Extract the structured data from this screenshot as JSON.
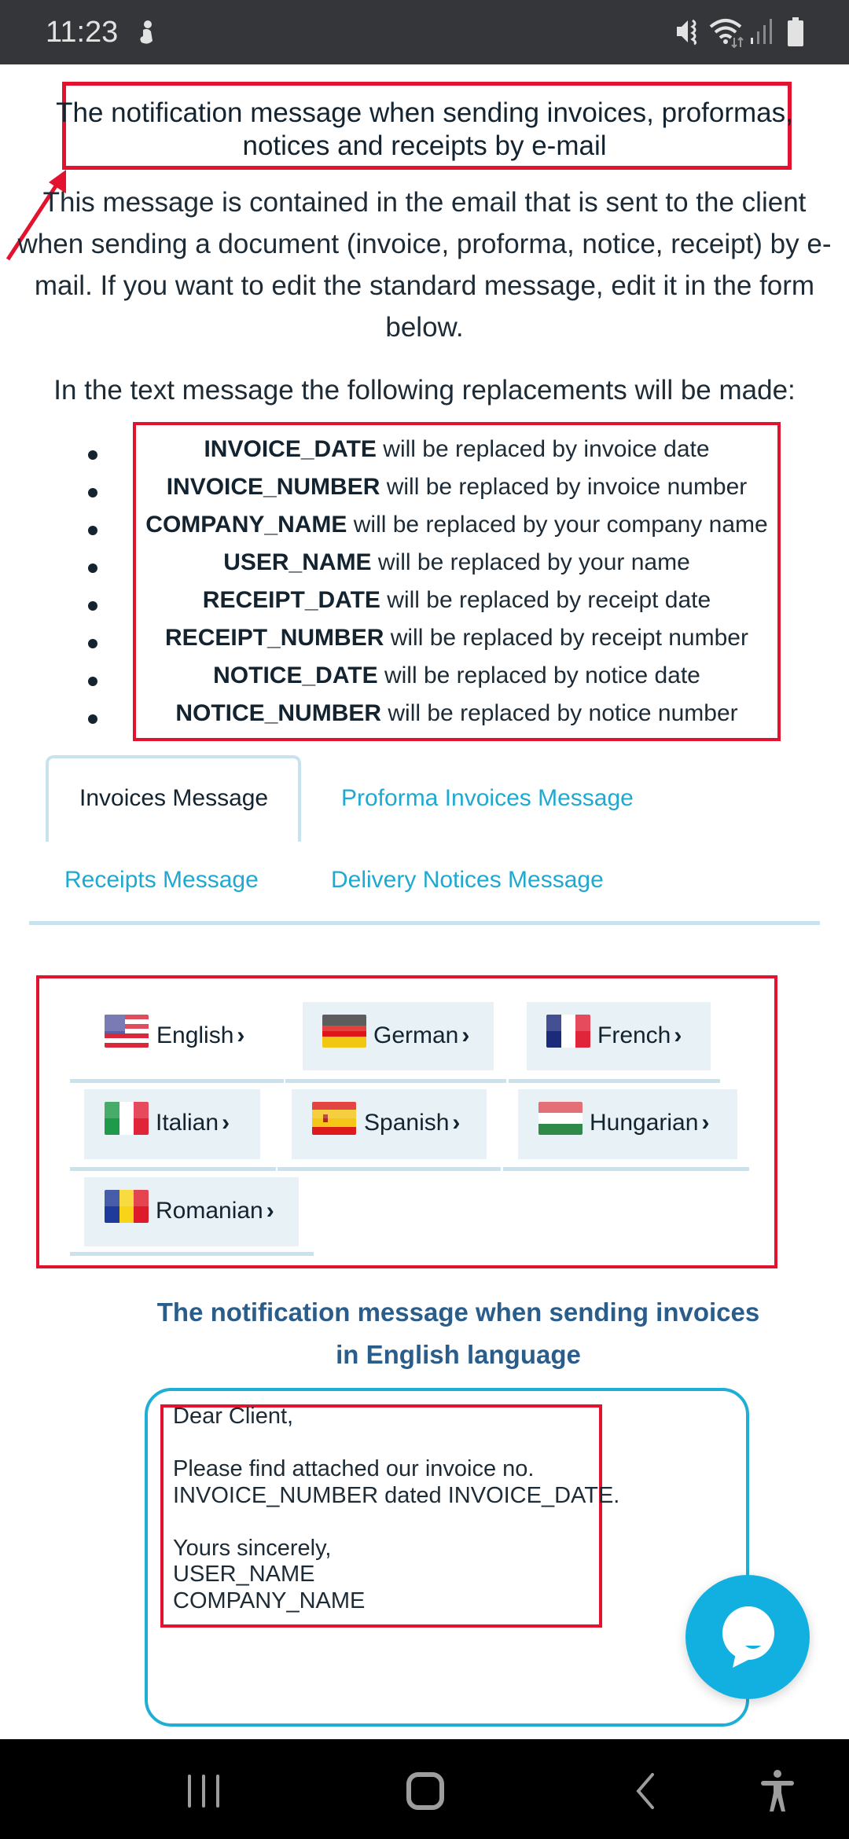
{
  "status_bar": {
    "time": "11:23",
    "icons": [
      "person-notification-icon",
      "mute-vibrate-icon",
      "wifi-data-icon",
      "signal-icon",
      "battery-icon"
    ]
  },
  "headline": {
    "line1": "The notification message when sending invoices, proformas,",
    "line2": "notices and receipts by e-mail"
  },
  "intro": {
    "lines": [
      "This message is contained in the email that is sent to the client",
      "when sending a document (invoice, proforma, notice, receipt) by e-",
      "mail. If you want to edit the standard message, edit it in the form",
      "below."
    ]
  },
  "replacements": {
    "intro": "In the text message the following replacements will be made:",
    "items": [
      {
        "key": "INVOICE_DATE",
        "text": " will be replaced by invoice date"
      },
      {
        "key": "INVOICE_NUMBER",
        "text": " will be replaced by invoice number"
      },
      {
        "key": "COMPANY_NAME",
        "text": " will be replaced by your company name"
      },
      {
        "key": "USER_NAME",
        "text": " will be replaced by your name"
      },
      {
        "key": "RECEIPT_DATE",
        "text": " will be replaced by receipt date"
      },
      {
        "key": "RECEIPT_NUMBER",
        "text": " will be replaced by receipt number"
      },
      {
        "key": "NOTICE_DATE",
        "text": " will be replaced by notice date"
      },
      {
        "key": "NOTICE_NUMBER",
        "text": " will be replaced by notice number"
      }
    ]
  },
  "tabs": {
    "items": [
      {
        "label": "Invoices Message",
        "active": true
      },
      {
        "label": "Proforma Invoices Message",
        "active": false
      },
      {
        "label": "Receipts Message",
        "active": false
      },
      {
        "label": "Delivery Notices Message",
        "active": false
      }
    ]
  },
  "languages": {
    "chevron": "›",
    "items": [
      {
        "label": "English",
        "flag": "us-flag-icon",
        "selected": true
      },
      {
        "label": "German",
        "flag": "germany-flag-icon",
        "selected": false
      },
      {
        "label": "French",
        "flag": "france-flag-icon",
        "selected": false
      },
      {
        "label": "Italian",
        "flag": "italy-flag-icon",
        "selected": false
      },
      {
        "label": "Spanish",
        "flag": "spain-flag-icon",
        "selected": false
      },
      {
        "label": "Hungarian",
        "flag": "hungary-flag-icon",
        "selected": false
      },
      {
        "label": "Romanian",
        "flag": "romania-flag-icon",
        "selected": false
      }
    ]
  },
  "message_section": {
    "title_line1": "The notification message when sending invoices",
    "title_line2": "in English language",
    "textarea_lines": [
      "Dear Client,",
      "",
      "Please find attached our invoice no.",
      "INVOICE_NUMBER dated INVOICE_DATE.",
      "",
      "Yours sincerely,",
      "USER_NAME",
      "COMPANY_NAME"
    ]
  },
  "colors": {
    "annotation_red": "#e3132f",
    "link_blue": "#1fa9d1",
    "accent_cyan": "#12b0e0",
    "tab_border": "#c9e3ee",
    "subtitle_blue": "#2a5d8a"
  },
  "nav_bar": {
    "buttons": [
      "recent-apps",
      "home",
      "back",
      "accessibility"
    ]
  }
}
